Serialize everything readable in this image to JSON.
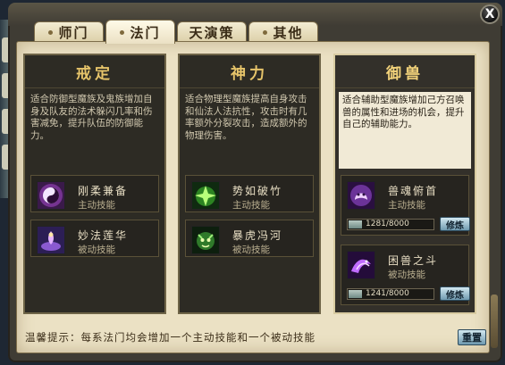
{
  "window": {
    "close_label": "X"
  },
  "tabs": [
    {
      "label": "师门"
    },
    {
      "label": "法门",
      "active": true
    },
    {
      "label": "天演策"
    },
    {
      "label": "其他"
    }
  ],
  "panels": [
    {
      "title": "戒定",
      "description": "适合防御型魔族及鬼族增加自身及队友的法术躲闪几率和伤害减免，提升队伍的防御能力。",
      "skills": [
        {
          "name": "刚柔兼备",
          "type": "主动技能",
          "icon": "yin-yang-icon"
        },
        {
          "name": "妙法莲华",
          "type": "被动技能",
          "icon": "lotus-figure-icon"
        }
      ]
    },
    {
      "title": "神力",
      "description": "适合物理型魔族提高自身攻击和仙法人法抗性，攻击时有几率额外分裂攻击，造成额外的物理伤害。",
      "skills": [
        {
          "name": "势如破竹",
          "type": "主动技能",
          "icon": "green-burst-icon"
        },
        {
          "name": "暴虎冯河",
          "type": "被动技能",
          "icon": "tiger-head-icon"
        }
      ]
    },
    {
      "title": "御兽",
      "selected": true,
      "description": "适合辅助型魔族增加己方召唤兽的属性和进场的机会，提升自己的辅助能力。",
      "skills": [
        {
          "name": "兽魂俯首",
          "type": "主动技能",
          "icon": "purple-beast-icon",
          "progress": "1281/8000",
          "progress_fraction": 0.16,
          "button": "修炼"
        },
        {
          "name": "困兽之斗",
          "type": "被动技能",
          "icon": "purple-dragon-icon",
          "progress": "1241/8000",
          "progress_fraction": 0.155,
          "button": "修炼"
        }
      ]
    }
  ],
  "footer": {
    "tip": "温馨提示：每系法门均会增加一个主动技能和一个被动技能",
    "reset_label": "重置"
  },
  "colors": {
    "panel_title": "#e6c46a",
    "paper": "#ebe1c4",
    "frame": "#3f3c34"
  }
}
